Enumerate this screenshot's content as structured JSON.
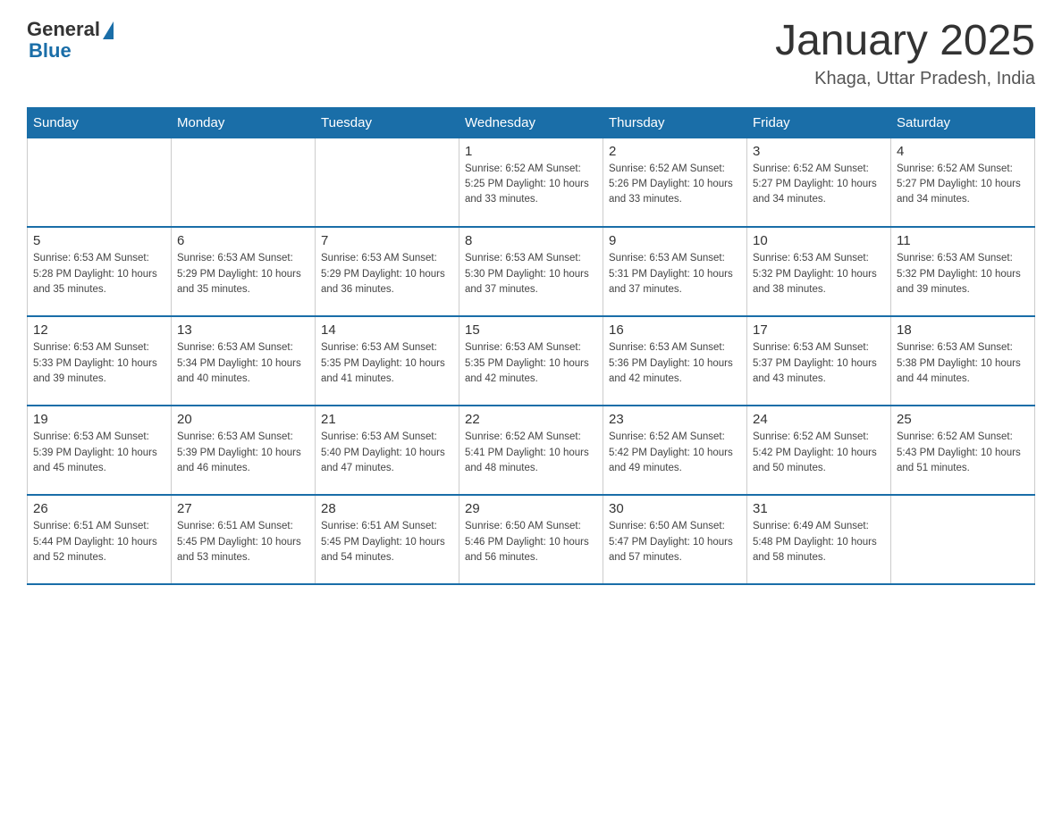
{
  "header": {
    "logo_general": "General",
    "logo_blue": "Blue",
    "month_title": "January 2025",
    "location": "Khaga, Uttar Pradesh, India"
  },
  "days_of_week": [
    "Sunday",
    "Monday",
    "Tuesday",
    "Wednesday",
    "Thursday",
    "Friday",
    "Saturday"
  ],
  "weeks": [
    [
      {
        "day": "",
        "info": ""
      },
      {
        "day": "",
        "info": ""
      },
      {
        "day": "",
        "info": ""
      },
      {
        "day": "1",
        "info": "Sunrise: 6:52 AM\nSunset: 5:25 PM\nDaylight: 10 hours\nand 33 minutes."
      },
      {
        "day": "2",
        "info": "Sunrise: 6:52 AM\nSunset: 5:26 PM\nDaylight: 10 hours\nand 33 minutes."
      },
      {
        "day": "3",
        "info": "Sunrise: 6:52 AM\nSunset: 5:27 PM\nDaylight: 10 hours\nand 34 minutes."
      },
      {
        "day": "4",
        "info": "Sunrise: 6:52 AM\nSunset: 5:27 PM\nDaylight: 10 hours\nand 34 minutes."
      }
    ],
    [
      {
        "day": "5",
        "info": "Sunrise: 6:53 AM\nSunset: 5:28 PM\nDaylight: 10 hours\nand 35 minutes."
      },
      {
        "day": "6",
        "info": "Sunrise: 6:53 AM\nSunset: 5:29 PM\nDaylight: 10 hours\nand 35 minutes."
      },
      {
        "day": "7",
        "info": "Sunrise: 6:53 AM\nSunset: 5:29 PM\nDaylight: 10 hours\nand 36 minutes."
      },
      {
        "day": "8",
        "info": "Sunrise: 6:53 AM\nSunset: 5:30 PM\nDaylight: 10 hours\nand 37 minutes."
      },
      {
        "day": "9",
        "info": "Sunrise: 6:53 AM\nSunset: 5:31 PM\nDaylight: 10 hours\nand 37 minutes."
      },
      {
        "day": "10",
        "info": "Sunrise: 6:53 AM\nSunset: 5:32 PM\nDaylight: 10 hours\nand 38 minutes."
      },
      {
        "day": "11",
        "info": "Sunrise: 6:53 AM\nSunset: 5:32 PM\nDaylight: 10 hours\nand 39 minutes."
      }
    ],
    [
      {
        "day": "12",
        "info": "Sunrise: 6:53 AM\nSunset: 5:33 PM\nDaylight: 10 hours\nand 39 minutes."
      },
      {
        "day": "13",
        "info": "Sunrise: 6:53 AM\nSunset: 5:34 PM\nDaylight: 10 hours\nand 40 minutes."
      },
      {
        "day": "14",
        "info": "Sunrise: 6:53 AM\nSunset: 5:35 PM\nDaylight: 10 hours\nand 41 minutes."
      },
      {
        "day": "15",
        "info": "Sunrise: 6:53 AM\nSunset: 5:35 PM\nDaylight: 10 hours\nand 42 minutes."
      },
      {
        "day": "16",
        "info": "Sunrise: 6:53 AM\nSunset: 5:36 PM\nDaylight: 10 hours\nand 42 minutes."
      },
      {
        "day": "17",
        "info": "Sunrise: 6:53 AM\nSunset: 5:37 PM\nDaylight: 10 hours\nand 43 minutes."
      },
      {
        "day": "18",
        "info": "Sunrise: 6:53 AM\nSunset: 5:38 PM\nDaylight: 10 hours\nand 44 minutes."
      }
    ],
    [
      {
        "day": "19",
        "info": "Sunrise: 6:53 AM\nSunset: 5:39 PM\nDaylight: 10 hours\nand 45 minutes."
      },
      {
        "day": "20",
        "info": "Sunrise: 6:53 AM\nSunset: 5:39 PM\nDaylight: 10 hours\nand 46 minutes."
      },
      {
        "day": "21",
        "info": "Sunrise: 6:53 AM\nSunset: 5:40 PM\nDaylight: 10 hours\nand 47 minutes."
      },
      {
        "day": "22",
        "info": "Sunrise: 6:52 AM\nSunset: 5:41 PM\nDaylight: 10 hours\nand 48 minutes."
      },
      {
        "day": "23",
        "info": "Sunrise: 6:52 AM\nSunset: 5:42 PM\nDaylight: 10 hours\nand 49 minutes."
      },
      {
        "day": "24",
        "info": "Sunrise: 6:52 AM\nSunset: 5:42 PM\nDaylight: 10 hours\nand 50 minutes."
      },
      {
        "day": "25",
        "info": "Sunrise: 6:52 AM\nSunset: 5:43 PM\nDaylight: 10 hours\nand 51 minutes."
      }
    ],
    [
      {
        "day": "26",
        "info": "Sunrise: 6:51 AM\nSunset: 5:44 PM\nDaylight: 10 hours\nand 52 minutes."
      },
      {
        "day": "27",
        "info": "Sunrise: 6:51 AM\nSunset: 5:45 PM\nDaylight: 10 hours\nand 53 minutes."
      },
      {
        "day": "28",
        "info": "Sunrise: 6:51 AM\nSunset: 5:45 PM\nDaylight: 10 hours\nand 54 minutes."
      },
      {
        "day": "29",
        "info": "Sunrise: 6:50 AM\nSunset: 5:46 PM\nDaylight: 10 hours\nand 56 minutes."
      },
      {
        "day": "30",
        "info": "Sunrise: 6:50 AM\nSunset: 5:47 PM\nDaylight: 10 hours\nand 57 minutes."
      },
      {
        "day": "31",
        "info": "Sunrise: 6:49 AM\nSunset: 5:48 PM\nDaylight: 10 hours\nand 58 minutes."
      },
      {
        "day": "",
        "info": ""
      }
    ]
  ]
}
